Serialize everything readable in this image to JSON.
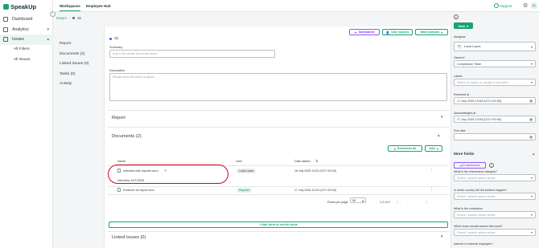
{
  "app": {
    "logo": "SpeakUp"
  },
  "sidebar": {
    "items": [
      {
        "label": "Dashboard"
      },
      {
        "label": "Analytics"
      },
      {
        "label": "Issues"
      }
    ],
    "sub_items": [
      {
        "label": "All Filters"
      },
      {
        "label": "All Issues"
      }
    ]
  },
  "topbar": {
    "tabs": [
      "Workspaces",
      "Employee Hub"
    ],
    "support": "Support",
    "avatar_initials": "LL"
  },
  "breadcrumb": {
    "root": "Issues",
    "current": "31"
  },
  "local_nav": [
    "Report",
    "Documents (2)",
    "Linked issues (0)",
    "Tasks (0)",
    "Activity"
  ],
  "actions": {
    "summarize": "Summarize",
    "user_access": "User access",
    "more_actions": "More actions"
  },
  "issue": {
    "id": "31",
    "summary_label": "Summary",
    "summary_placeholder": "Add a few words about this issue",
    "description_label": "Description",
    "description_placeholder": "Please what the issue is about..."
  },
  "sections": {
    "report": "Report",
    "documents": "Documents (2)",
    "linked_issues": "Linked issues (0)"
  },
  "documents": {
    "download_all": "Download all",
    "add": "Add",
    "columns": [
      "Name",
      "User",
      "Date added"
    ],
    "rows": [
      {
        "name": "Interview with reporter.docx",
        "user": "Lucia Lopez",
        "date": "18 July 2025 13:51 (UTC+02:00)"
      },
      {
        "name": "Evidence for report.docx",
        "user": "Reporter",
        "date": "17 July 2025 14:39 (UTC+02:00)"
      }
    ],
    "tooltip": "Interview 1/07/2025",
    "rows_per_page_label": "Rows per page",
    "rows_per_page": "50",
    "range": "1-2 of 2"
  },
  "add_form": "+ Add form to enrich issue",
  "right_panel": {
    "new_button": "New",
    "assignee_label": "Assignee",
    "assignee": "Lucia Lopez",
    "assignee_initials": "LL",
    "owners_label": "Owners*",
    "owners": "Compliance Team",
    "labels_label": "Labels",
    "labels_placeholder": "Select an option or create a new label",
    "received_label": "Received at",
    "received": "17 July 2025 13:53 (UTC+02:00)",
    "ack_label": "Acknowledged at",
    "ack": "17 July 2025 13:53 (UTC+02:00)",
    "due_label": "Due date",
    "due": "",
    "more_fields": "More fields",
    "ai_assistance": "AI assistance",
    "q1_label": "What is the misconduct category?",
    "q2_label": "In which country did the incident happen?",
    "q3_label": "What is the conclusion",
    "q4_label": "Which team should assess this issue?",
    "q5_label": "Internal or external employee?",
    "select_placeholder": "Select / search option below"
  },
  "colors": {
    "accent": "#1aa371",
    "ai": "#7c3aed",
    "highlight": "#d0021b"
  }
}
